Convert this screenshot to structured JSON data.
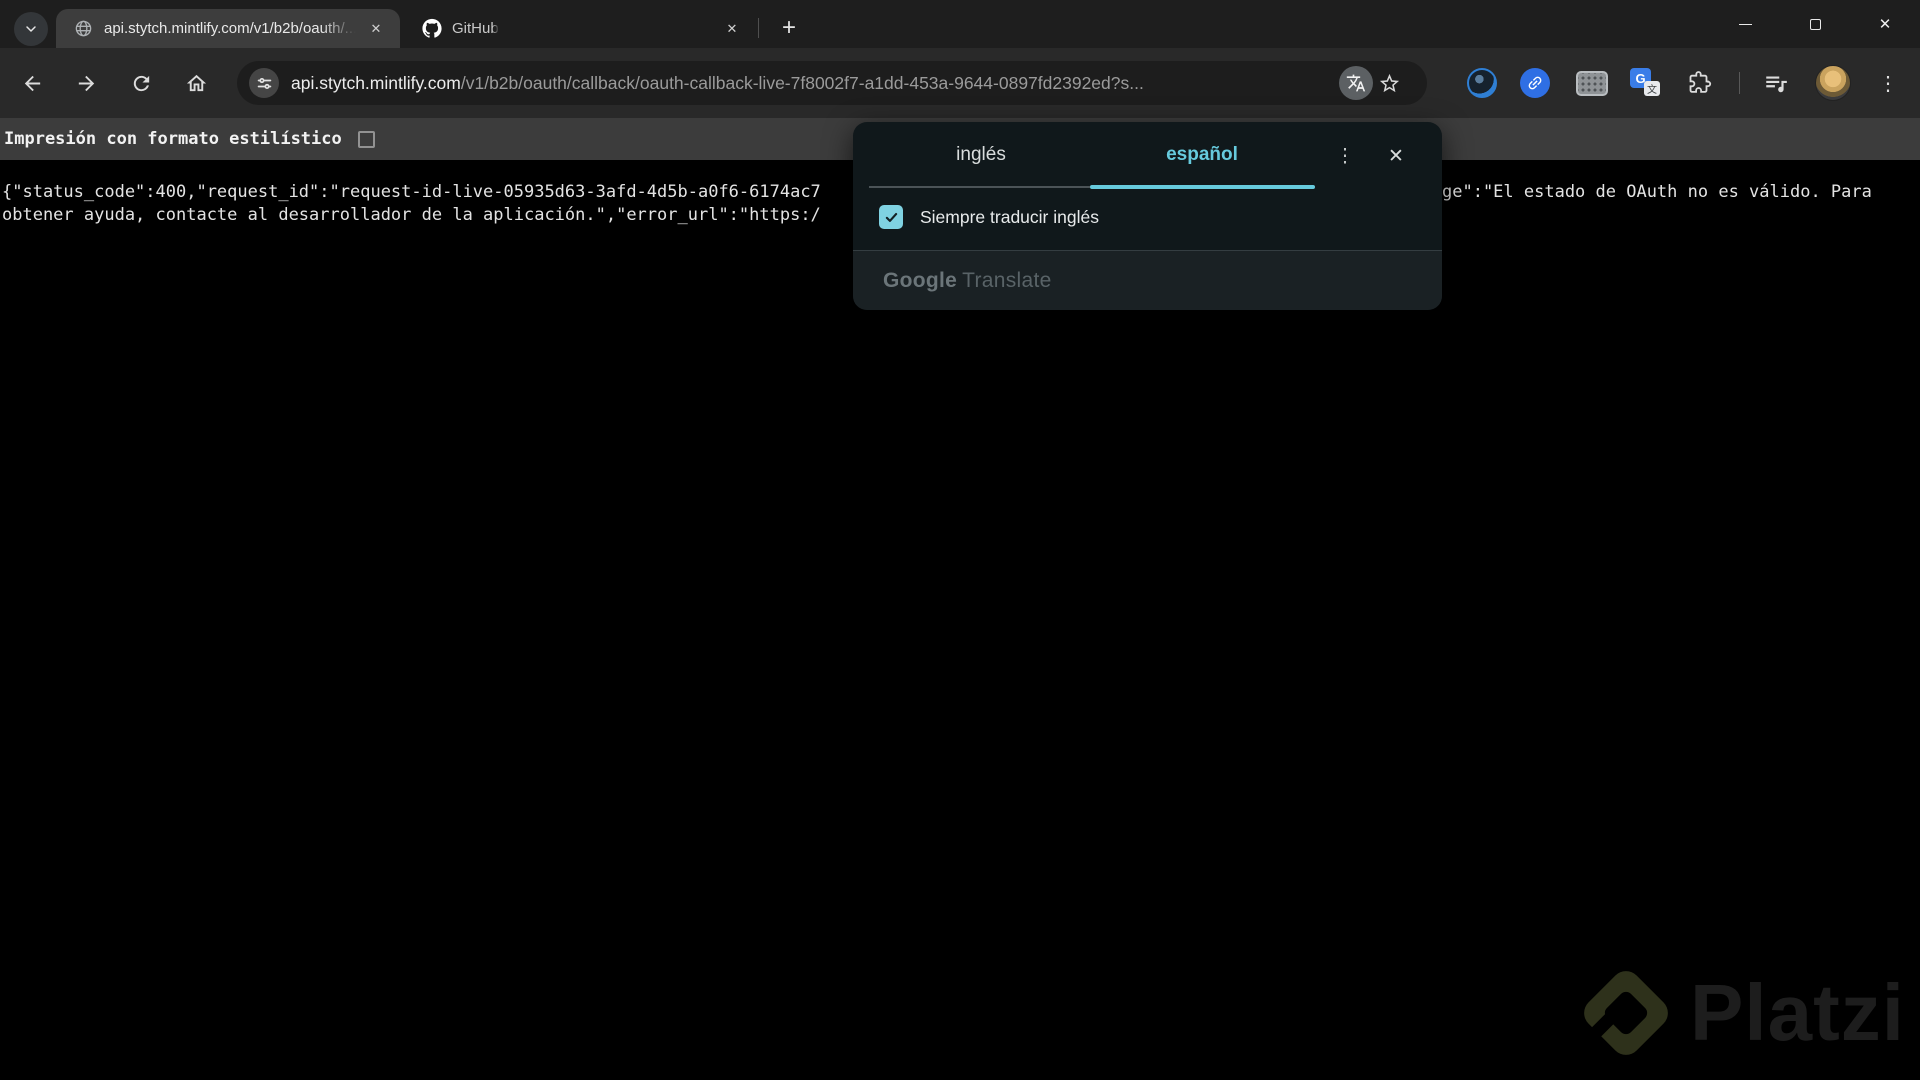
{
  "tab_strip": {
    "tabs": [
      {
        "title": "api.stytch.mintlify.com/v1/b2b/oauth/...",
        "favicon": "globe-icon",
        "active": true
      },
      {
        "title": "GitHub",
        "favicon": "github-icon",
        "active": false
      }
    ]
  },
  "toolbar": {
    "url": {
      "domain": "api.stytch.mintlify.com",
      "path": "/v1/b2b/oauth/callback/oauth-callback-live-7f8002f7-a1dd-453a-9644-0897fd2392ed?s..."
    },
    "icons": [
      "back-icon",
      "forward-icon",
      "reload-icon",
      "home-icon",
      "tune-icon",
      "translate-badge-icon",
      "bookmark-star-icon",
      "sphere-extension-icon",
      "link-extension-icon",
      "keyboard-extension-icon",
      "translate-extension-icon",
      "extensions-puzzle-icon",
      "media-playlist-icon",
      "avatar",
      "kebab-menu-icon"
    ]
  },
  "page": {
    "pretty_print": {
      "label": "Impresión con formato estilístico",
      "checked": false
    },
    "json_body": {
      "line1_left": "{\"status_code\":400,\"request_id\":\"request-id-live-05935d63-3afd-4d5b-a0f6-6174ac7",
      "line1_right": "ge\":\"El estado de OAuth no es válido. Para",
      "line2": "obtener ayuda, contacte al desarrollador de la aplicación.\",\"error_url\":\"https:/"
    }
  },
  "translate_popup": {
    "source_tab": "inglés",
    "target_tab": "español",
    "always_translate": {
      "label": "Siempre traducir inglés",
      "checked": true
    },
    "brand_google": "Google",
    "brand_translate": "Translate"
  },
  "watermark": {
    "text": "Platzi"
  },
  "colors": {
    "accent_cyan": "#66cadd",
    "checkbox_fill": "#7fd2e2",
    "tabstrip_bg": "#1e1e1e",
    "toolbar_bg": "#292929",
    "active_tab_bg": "#3d3d3d",
    "popup_bg": "#10181b",
    "page_bg": "#000000"
  }
}
